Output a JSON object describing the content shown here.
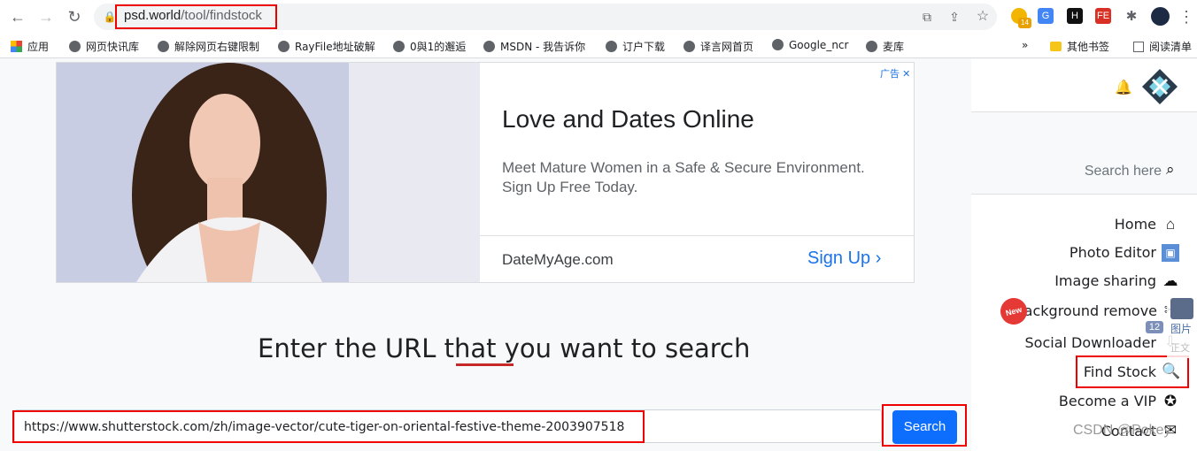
{
  "browser": {
    "url_host": "psd.world",
    "url_path": "/tool/findstock",
    "extension_badge": "14",
    "bookmarks": [
      "应用",
      "网页快讯库",
      "解除网页右键限制",
      "RayFile地址破解",
      "0與1的邂逅",
      "MSDN - 我告诉你",
      "订户下载",
      "译言网首页",
      "Google_ncr",
      "麦库"
    ],
    "bookmarks_overflow": "»",
    "other_bookmarks": "其他书签",
    "reading_list": "阅读清单"
  },
  "ad": {
    "badge": "广告",
    "title": "Love and Dates Online",
    "body": "Meet Mature Women in a Safe & Secure Environment. Sign Up Free Today.",
    "domain": "DateMyAge.com",
    "cta": "Sign Up"
  },
  "main": {
    "heading": "Enter the URL that you want to search",
    "input_value": "https://www.shutterstock.com/zh/image-vector/cute-tiger-on-oriental-festive-theme-2003907518",
    "search_button": "Search"
  },
  "sidebar": {
    "search_label": "Search here",
    "items": [
      {
        "label": "Home",
        "icon": "home-icon"
      },
      {
        "label": "Photo Editor",
        "icon": "photo-editor-icon"
      },
      {
        "label": "Image sharing",
        "icon": "cloud-upload-icon"
      },
      {
        "label": "Background remove",
        "icon": "background-remove-icon"
      },
      {
        "label": "Social Downloader",
        "icon": "download-icon"
      },
      {
        "label": "Find Stock",
        "icon": "magnifier-icon"
      },
      {
        "label": "Become a VIP",
        "icon": "medal-icon"
      },
      {
        "label": "Contact",
        "icon": "envelope-icon"
      }
    ],
    "new_badge": "New"
  },
  "floating_widget": {
    "count": "12",
    "label1": "图片",
    "label2": "正文"
  },
  "watermark": "CSDN @Pokey",
  "colors": {
    "accent": "#0d6efd",
    "highlight": "#e00000"
  }
}
